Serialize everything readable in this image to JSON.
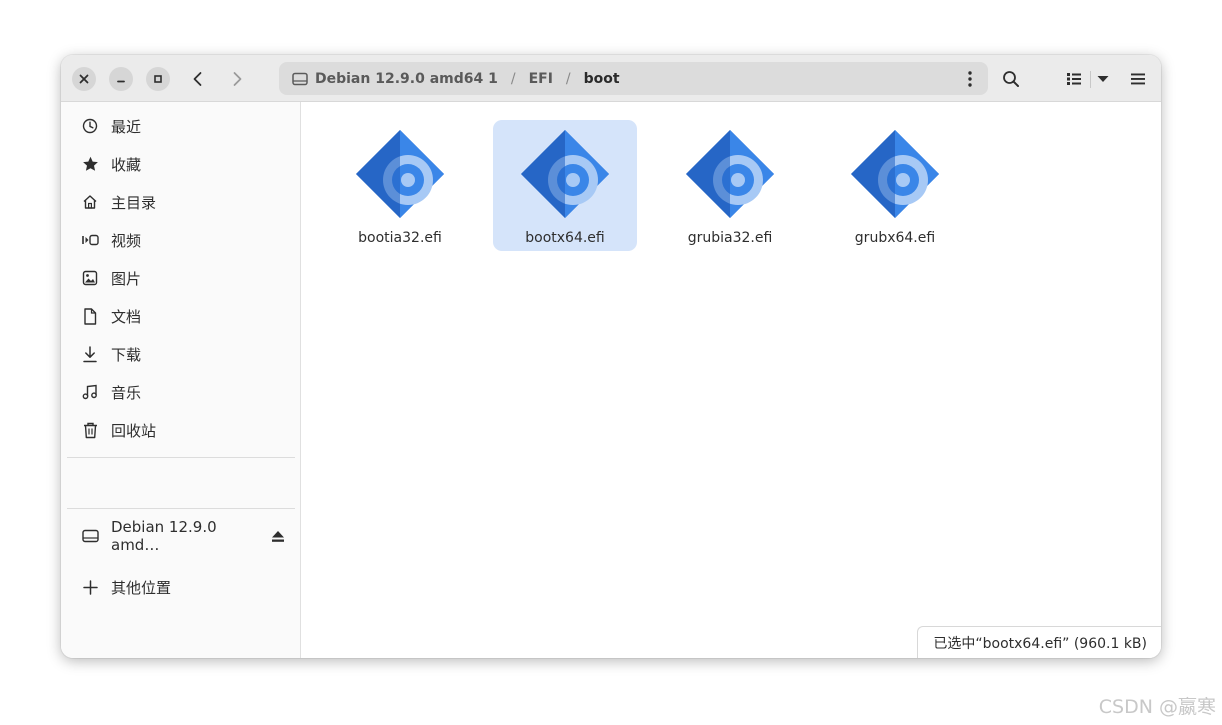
{
  "window": {
    "controls": {
      "close": "close-icon",
      "minimize": "minimize-icon",
      "maximize": "maximize-icon"
    },
    "nav": {
      "back": "chevron-left-icon",
      "forward": "chevron-right-icon"
    }
  },
  "pathbar": {
    "drive_icon": "drive-icon",
    "crumbs": [
      {
        "label": "Debian 12.9.0 amd64 1"
      },
      {
        "label": "EFI"
      },
      {
        "label": "boot"
      }
    ],
    "separator": "/",
    "menu_icon": "vertical-dots-icon"
  },
  "toolbar": {
    "search_icon": "search-icon",
    "view_icon": "list-view-icon",
    "dropdown_icon": "caret-down-icon",
    "menu_icon": "hamburger-icon"
  },
  "sidebar": {
    "places": [
      {
        "label": "最近",
        "icon": "clock-icon"
      },
      {
        "label": "收藏",
        "icon": "star-icon"
      },
      {
        "label": "主目录",
        "icon": "home-icon"
      },
      {
        "label": "视频",
        "icon": "video-icon"
      },
      {
        "label": "图片",
        "icon": "image-icon"
      },
      {
        "label": "文档",
        "icon": "document-icon"
      },
      {
        "label": "下载",
        "icon": "download-icon"
      },
      {
        "label": "音乐",
        "icon": "music-icon"
      },
      {
        "label": "回收站",
        "icon": "trash-icon"
      }
    ],
    "devices": [
      {
        "label": "Debian 12.9.0 amd…",
        "icon": "drive-icon",
        "action_icon": "eject-icon"
      }
    ],
    "other": {
      "label": "其他位置",
      "icon": "plus-icon"
    }
  },
  "files": [
    {
      "name": "bootia32.efi",
      "selected": false
    },
    {
      "name": "bootx64.efi",
      "selected": true
    },
    {
      "name": "grubia32.efi",
      "selected": false
    },
    {
      "name": "grubx64.efi",
      "selected": false
    }
  ],
  "status": {
    "text": "已选中“bootx64.efi” (960.1 kB)"
  },
  "watermark": {
    "text": "CSDN @嬴寒"
  },
  "colors": {
    "accent": "#3584e4",
    "selection": "#d5e4fa",
    "headerbar": "#ebebeb"
  }
}
